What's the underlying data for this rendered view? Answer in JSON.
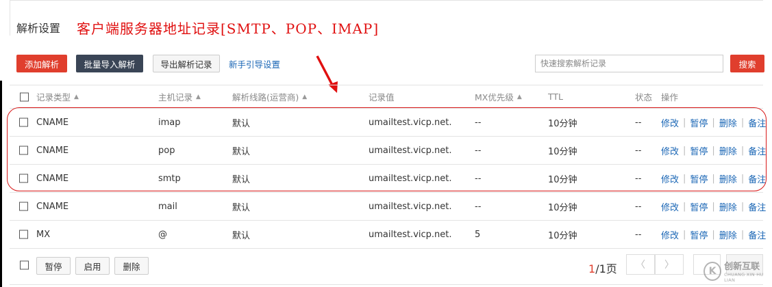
{
  "page": {
    "title": "解析设置"
  },
  "annotation": {
    "text": "客户端服务器地址记录[SMTP、POP、IMAP]",
    "color": "#e01010"
  },
  "toolbar": {
    "add_label": "添加解析",
    "batch_import_label": "批量导入解析",
    "export_label": "导出解析记录",
    "guide_label": "新手引导设置",
    "search_placeholder": "快速搜索解析记录",
    "search_label": "搜索"
  },
  "table": {
    "headers": {
      "type": "记录类型",
      "host": "主机记录",
      "line": "解析线路(运营商)",
      "value": "记录值",
      "mx": "MX优先级",
      "ttl": "TTL",
      "status": "状态",
      "ops": "操作"
    },
    "sort_icon": "triangle-up-icon",
    "actions": {
      "edit": "修改",
      "pause": "暂停",
      "delete": "删除",
      "note": "备注"
    },
    "rows": [
      {
        "type": "CNAME",
        "host": "imap",
        "line": "默认",
        "value": "umailtest.vicp.net.",
        "mx": "--",
        "ttl": "10分钟",
        "status": "--"
      },
      {
        "type": "CNAME",
        "host": "pop",
        "line": "默认",
        "value": "umailtest.vicp.net.",
        "mx": "--",
        "ttl": "10分钟",
        "status": "--"
      },
      {
        "type": "CNAME",
        "host": "smtp",
        "line": "默认",
        "value": "umailtest.vicp.net.",
        "mx": "--",
        "ttl": "10分钟",
        "status": "--"
      },
      {
        "type": "CNAME",
        "host": "mail",
        "line": "默认",
        "value": "umailtest.vicp.net.",
        "mx": "--",
        "ttl": "10分钟",
        "status": "--"
      },
      {
        "type": "MX",
        "host": "@",
        "line": "默认",
        "value": "umailtest.vicp.net.",
        "mx": "5",
        "ttl": "10分钟",
        "status": "--"
      }
    ]
  },
  "bottom": {
    "pause_label": "暂停",
    "enable_label": "启用",
    "delete_label": "删除",
    "page_current": "1",
    "page_total": "/1页",
    "prev_icon": "chevron-left-icon",
    "next_icon": "chevron-right-icon"
  },
  "watermark": {
    "logo_letter": "K",
    "cn": "创新互联",
    "en": "CHUANG XIN HU LIAN"
  },
  "colors": {
    "primary_red": "#e03e2d",
    "dark_button": "#3a4556",
    "link_blue": "#1a66b5"
  }
}
